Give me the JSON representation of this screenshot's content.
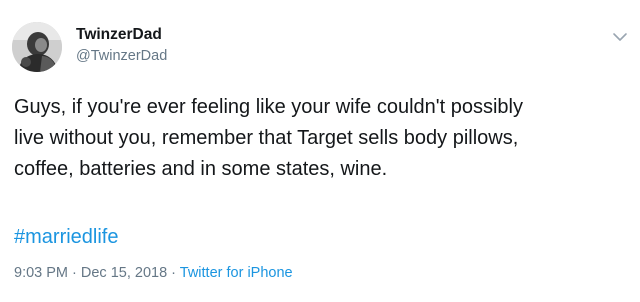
{
  "user": {
    "display_name": "TwinzerDad",
    "handle": "@TwinzerDad"
  },
  "tweet": {
    "text_lines": [
      "Guys, if you're ever feeling like your wife couldn't possibly",
      "live without you, remember that Target sells body pillows,",
      "coffee, batteries and in some states, wine."
    ],
    "hashtag": "#marriedlife",
    "time": "9:03 PM",
    "separator_1": " · ",
    "date": "Dec 15, 2018",
    "separator_2": " · ",
    "source": "Twitter for iPhone"
  },
  "icons": {
    "menu": "chevron-down-icon",
    "avatar": "avatar"
  },
  "colors": {
    "text": "#14171a",
    "secondary": "#657786",
    "link": "#1b95e0",
    "background": "#ffffff"
  }
}
